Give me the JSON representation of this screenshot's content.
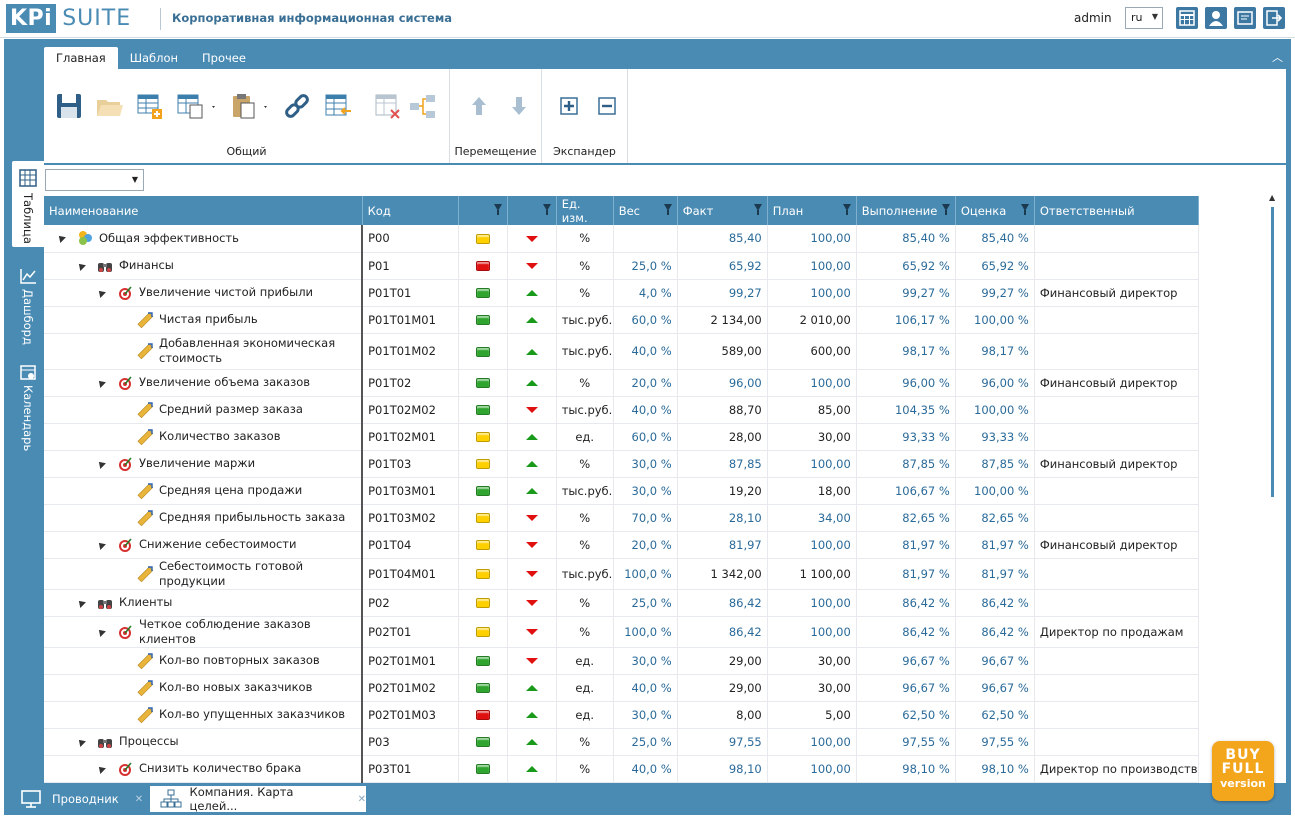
{
  "header": {
    "logo_kpi": "KPi",
    "logo_suite": "SUITE",
    "app_title": "Корпоративная информационная система",
    "user": "admin",
    "language": "ru",
    "buttons": [
      "calendar-grid-icon",
      "user-icon",
      "report-icon",
      "logout-icon"
    ]
  },
  "ribbon": {
    "tabs": [
      "Главная",
      "Шаблон",
      "Прочее"
    ],
    "groups": {
      "general": "Общий",
      "move": "Перемещение",
      "expander": "Экспандер"
    }
  },
  "side_tabs": [
    "Таблица",
    "Дашборд",
    "Календарь"
  ],
  "grid": {
    "columns": [
      "Наименование",
      "Код",
      "",
      "",
      "Ед. изм.",
      "Вес",
      "Факт",
      "План",
      "Выполнение",
      "Оценка",
      "Ответственный"
    ],
    "rows": [
      {
        "level": 0,
        "icon": "kpi-cluster-icon",
        "name": "Общая эффективность",
        "code": "P00",
        "lamp": "y",
        "trend": "down",
        "unit": "%",
        "weight": "",
        "fact": "85,40",
        "plan": "100,00",
        "perf": "85,40 %",
        "score": "85,40 %",
        "owner": ""
      },
      {
        "level": 1,
        "icon": "binoculars-icon",
        "name": "Финансы",
        "code": "P01",
        "lamp": "r",
        "trend": "down",
        "unit": "%",
        "weight": "25,0 %",
        "fact": "65,92",
        "plan": "100,00",
        "perf": "65,92 %",
        "score": "65,92 %",
        "owner": ""
      },
      {
        "level": 2,
        "icon": "target-icon",
        "name": "Увеличение чистой прибыли",
        "code": "P01T01",
        "lamp": "g",
        "trend": "up",
        "unit": "%",
        "weight": "4,0 %",
        "fact": "99,27",
        "plan": "100,00",
        "perf": "99,27 %",
        "score": "99,27 %",
        "owner": "Финансовый директор"
      },
      {
        "level": 3,
        "icon": "ruler-icon",
        "name": "Чистая прибыль",
        "code": "P01T01M01",
        "lamp": "g",
        "trend": "up",
        "unit": "тыс.руб.",
        "weight": "60,0 %",
        "fact": "2 134,00",
        "plan": "2 010,00",
        "perf": "106,17 %",
        "score": "100,00 %",
        "owner": ""
      },
      {
        "level": 3,
        "icon": "ruler-icon",
        "name": "Добавленная экономическая стоимость",
        "code": "P01T01M02",
        "lamp": "g",
        "trend": "up",
        "unit": "тыс.руб.",
        "weight": "40,0 %",
        "fact": "589,00",
        "plan": "600,00",
        "perf": "98,17 %",
        "score": "98,17 %",
        "owner": "",
        "tall": true
      },
      {
        "level": 2,
        "icon": "target-icon",
        "name": "Увеличение объема заказов",
        "code": "P01T02",
        "lamp": "g",
        "trend": "up",
        "unit": "%",
        "weight": "20,0 %",
        "fact": "96,00",
        "plan": "100,00",
        "perf": "96,00 %",
        "score": "96,00 %",
        "owner": "Финансовый директор"
      },
      {
        "level": 3,
        "icon": "ruler-icon",
        "name": "Средний размер заказа",
        "code": "P01T02M02",
        "lamp": "g",
        "trend": "down",
        "unit": "тыс.руб.",
        "weight": "40,0 %",
        "fact": "88,70",
        "plan": "85,00",
        "perf": "104,35 %",
        "score": "100,00 %",
        "owner": ""
      },
      {
        "level": 3,
        "icon": "ruler-icon",
        "name": "Количество заказов",
        "code": "P01T02M01",
        "lamp": "y",
        "trend": "up",
        "unit": "ед.",
        "weight": "60,0 %",
        "fact": "28,00",
        "plan": "30,00",
        "perf": "93,33 %",
        "score": "93,33 %",
        "owner": ""
      },
      {
        "level": 2,
        "icon": "target-icon",
        "name": "Увеличение маржи",
        "code": "P01T03",
        "lamp": "y",
        "trend": "up",
        "unit": "%",
        "weight": "30,0 %",
        "fact": "87,85",
        "plan": "100,00",
        "perf": "87,85 %",
        "score": "87,85 %",
        "owner": "Финансовый директор"
      },
      {
        "level": 3,
        "icon": "ruler-icon",
        "name": "Средняя цена продажи",
        "code": "P01T03M01",
        "lamp": "g",
        "trend": "up",
        "unit": "тыс.руб.",
        "weight": "30,0 %",
        "fact": "19,20",
        "plan": "18,00",
        "perf": "106,67 %",
        "score": "100,00 %",
        "owner": ""
      },
      {
        "level": 3,
        "icon": "ruler-icon",
        "name": "Средняя прибыльность заказа",
        "code": "P01T03M02",
        "lamp": "y",
        "trend": "down",
        "unit": "%",
        "weight": "70,0 %",
        "fact": "28,10",
        "plan": "34,00",
        "perf": "82,65 %",
        "score": "82,65 %",
        "owner": ""
      },
      {
        "level": 2,
        "icon": "target-icon",
        "name": "Снижение себестоимости",
        "code": "P01T04",
        "lamp": "y",
        "trend": "down",
        "unit": "%",
        "weight": "20,0 %",
        "fact": "81,97",
        "plan": "100,00",
        "perf": "81,97 %",
        "score": "81,97 %",
        "owner": "Финансовый директор"
      },
      {
        "level": 3,
        "icon": "ruler-icon",
        "name": "Себестоимость готовой продукции",
        "code": "P01T04M01",
        "lamp": "y",
        "trend": "down",
        "unit": "тыс.руб.",
        "weight": "100,0 %",
        "fact": "1 342,00",
        "plan": "1 100,00",
        "perf": "81,97 %",
        "score": "81,97 %",
        "owner": ""
      },
      {
        "level": 1,
        "icon": "binoculars-icon",
        "name": "Клиенты",
        "code": "P02",
        "lamp": "y",
        "trend": "down",
        "unit": "%",
        "weight": "25,0 %",
        "fact": "86,42",
        "plan": "100,00",
        "perf": "86,42 %",
        "score": "86,42 %",
        "owner": ""
      },
      {
        "level": 2,
        "icon": "target-icon",
        "name": "Четкое соблюдение заказов клиентов",
        "code": "P02T01",
        "lamp": "y",
        "trend": "down",
        "unit": "%",
        "weight": "100,0 %",
        "fact": "86,42",
        "plan": "100,00",
        "perf": "86,42 %",
        "score": "86,42 %",
        "owner": "Директор по продажам"
      },
      {
        "level": 3,
        "icon": "ruler-icon",
        "name": "Кол-во повторных заказов",
        "code": "P02T01M01",
        "lamp": "g",
        "trend": "down",
        "unit": "ед.",
        "weight": "30,0 %",
        "fact": "29,00",
        "plan": "30,00",
        "perf": "96,67 %",
        "score": "96,67 %",
        "owner": ""
      },
      {
        "level": 3,
        "icon": "ruler-icon",
        "name": "Кол-во новых заказчиков",
        "code": "P02T01M02",
        "lamp": "g",
        "trend": "up",
        "unit": "ед.",
        "weight": "40,0 %",
        "fact": "29,00",
        "plan": "30,00",
        "perf": "96,67 %",
        "score": "96,67 %",
        "owner": ""
      },
      {
        "level": 3,
        "icon": "ruler-icon",
        "name": "Кол-во упущенных заказчиков",
        "code": "P02T01M03",
        "lamp": "r",
        "trend": "up",
        "unit": "ед.",
        "weight": "30,0 %",
        "fact": "8,00",
        "plan": "5,00",
        "perf": "62,50 %",
        "score": "62,50 %",
        "owner": ""
      },
      {
        "level": 1,
        "icon": "binoculars-icon",
        "name": "Процессы",
        "code": "P03",
        "lamp": "g",
        "trend": "up",
        "unit": "%",
        "weight": "25,0 %",
        "fact": "97,55",
        "plan": "100,00",
        "perf": "97,55 %",
        "score": "97,55 %",
        "owner": ""
      },
      {
        "level": 2,
        "icon": "target-icon",
        "name": "Снизить количество брака",
        "code": "P03T01",
        "lamp": "g",
        "trend": "up",
        "unit": "%",
        "weight": "40,0 %",
        "fact": "98,10",
        "plan": "100,00",
        "perf": "98,10 %",
        "score": "98,10 %",
        "owner": "Директор по производству"
      }
    ]
  },
  "bottom_tabs": [
    {
      "label": "Проводник",
      "icon": "monitor-icon"
    },
    {
      "label": "Компания. Карта целей...",
      "icon": "org-chart-icon"
    }
  ],
  "badge": {
    "line1": "BUY",
    "line2": "FULL",
    "line3": "version"
  },
  "colors": {
    "accent": "#4a8bb4",
    "lamp_yellow": "#ffd000",
    "lamp_green": "#2fa52f",
    "lamp_red": "#e01010"
  }
}
